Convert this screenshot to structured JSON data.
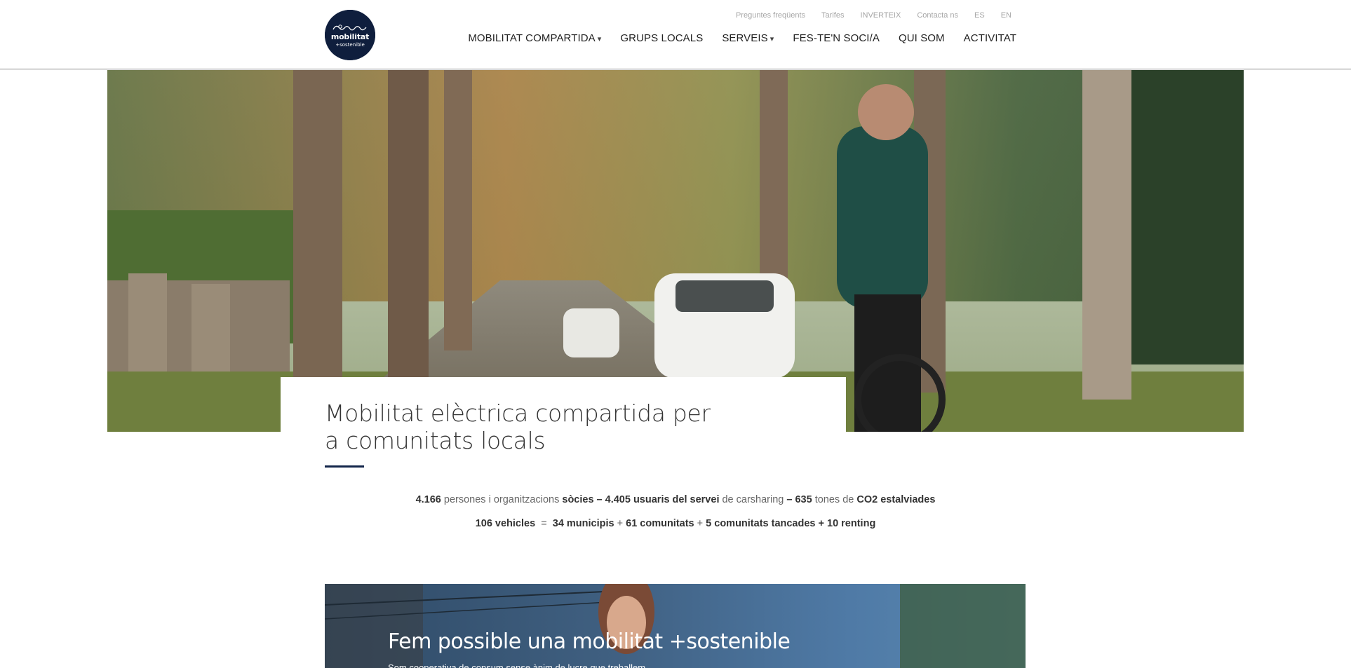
{
  "logo": {
    "word": "mobilitat",
    "sub": "+sostenible",
    "script": "Som"
  },
  "topbar": [
    "Preguntes freqüents",
    "Tarifes",
    "INVERTEIX",
    "Contacta ns",
    "ES",
    "EN"
  ],
  "nav": [
    {
      "label": "MOBILITAT COMPARTIDA",
      "caret": "▾"
    },
    {
      "label": "GRUPS LOCALS",
      "caret": ""
    },
    {
      "label": "SERVEIS",
      "caret": "▾"
    },
    {
      "label": "FES-TE'N SOCI/A",
      "caret": ""
    },
    {
      "label": "QUI SOM",
      "caret": ""
    },
    {
      "label": "ACTIVITAT",
      "caret": ""
    }
  ],
  "hero": {
    "title": "Mobilitat elèctrica compartida per a comunitats locals"
  },
  "stats": {
    "line1": {
      "persons": "4.166",
      "t1": " persones i organitzacions ",
      "socis": "sòcies – 4.405 usuaris del servei",
      "t2": " de carsharing ",
      "tones": "– 635",
      "t3": " tones de ",
      "co2": "CO2 estalviades"
    },
    "line2": {
      "vehicles": "106 vehicles",
      "eq": "  =  ",
      "municipis": "34 municipis",
      "p1": " + ",
      "comunitats": "61 comunitats",
      "p2": " + ",
      "tancades": "5 comunitats tancades + 10 renting"
    }
  },
  "banner": {
    "title": "Fem possible una mobilitat +sostenible",
    "subtitle": "Som cooperativa de consum sense ànim de lucre que treballem"
  },
  "colors": {
    "navy": "#0f1e3d",
    "rule": "#12254a",
    "topbar_text": "#a6a6a6"
  }
}
